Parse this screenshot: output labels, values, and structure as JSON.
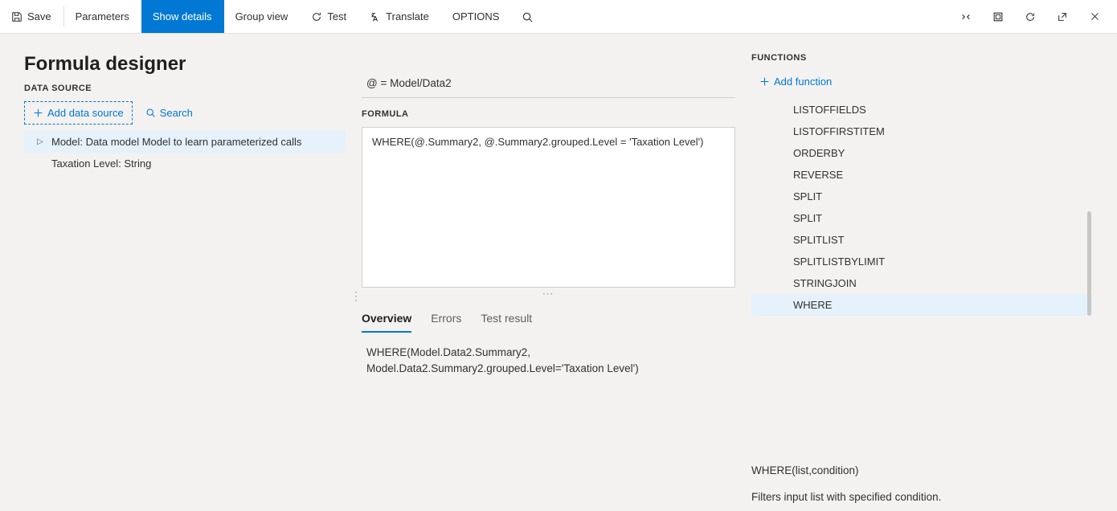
{
  "toolbar": {
    "save": "Save",
    "parameters": "Parameters",
    "show_details": "Show details",
    "group_view": "Group view",
    "test": "Test",
    "translate": "Translate",
    "options": "OPTIONS"
  },
  "page_title": "Formula designer",
  "data_source": {
    "section_label": "DATA SOURCE",
    "add_label": "Add data source",
    "search_label": "Search",
    "items": [
      {
        "label": "Model: Data model Model to learn parameterized calls",
        "selected": true,
        "expandable": true
      },
      {
        "label": "Taxation Level: String",
        "selected": false,
        "expandable": false
      }
    ]
  },
  "formula": {
    "header": "@ = Model/Data2",
    "section_label": "FORMULA",
    "editor_value": "WHERE(@.Summary2, @.Summary2.grouped.Level = 'Taxation Level')",
    "tabs": [
      {
        "label": "Overview",
        "active": true
      },
      {
        "label": "Errors",
        "active": false
      },
      {
        "label": "Test result",
        "active": false
      }
    ],
    "overview_line1": "WHERE(Model.Data2.Summary2,",
    "overview_line2": "Model.Data2.Summary2.grouped.Level='Taxation Level')"
  },
  "functions": {
    "section_label": "FUNCTIONS",
    "add_label": "Add function",
    "items": [
      "LISTOFFIELDS",
      "LISTOFFIRSTITEM",
      "ORDERBY",
      "REVERSE",
      "SPLIT",
      "SPLIT",
      "SPLITLIST",
      "SPLITLISTBYLIMIT",
      "STRINGJOIN",
      "WHERE"
    ],
    "selected_index": 9,
    "syntax": "WHERE(list,condition)",
    "description": "Filters input list with specified condition."
  }
}
